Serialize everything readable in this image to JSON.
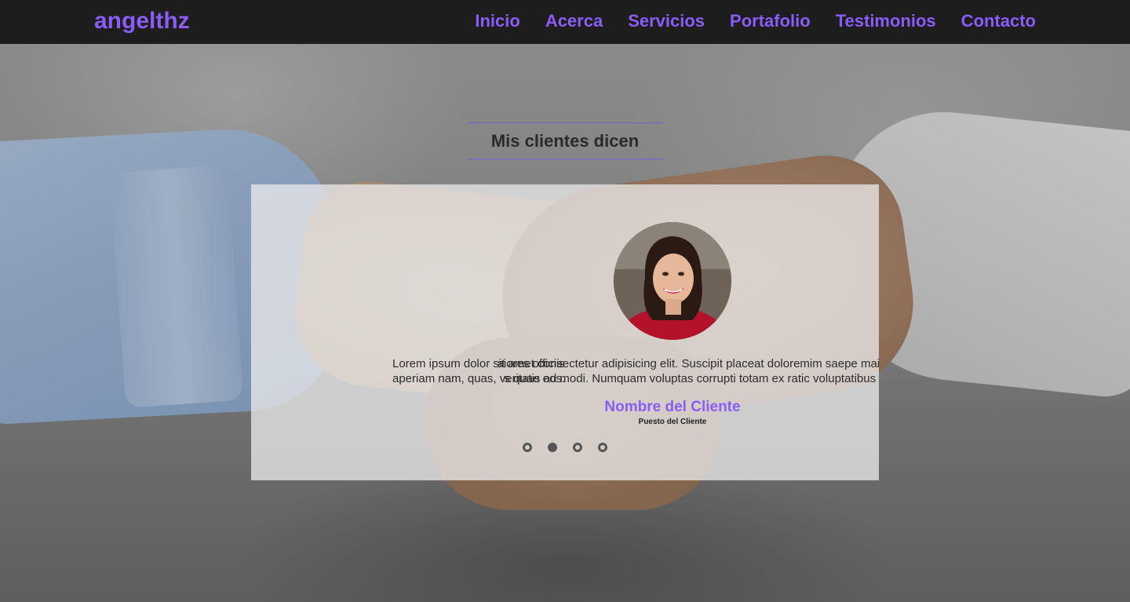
{
  "header": {
    "brand": "angelthz",
    "nav": [
      "Inicio",
      "Acerca",
      "Servicios",
      "Portafolio",
      "Testimonios",
      "Contacto"
    ]
  },
  "section": {
    "title": "Mis clientes dicen"
  },
  "testimonial": {
    "quote_line1": "Lorem ipsum dolor sit amet consectetur adipisicing elit. Suscipit placeat doloremim saepe maior",
    "quote_line2": "aperiam nam, quas, veritatis ad modi. Numquam voluptas corrupti totam ex ratic voluptatibus qu",
    "prev_line1": "aiores officiis",
    "prev_line2": "s quae eos.",
    "client_name": "Nombre del Cliente",
    "client_role": "Puesto del Cliente"
  },
  "carousel": {
    "total": 4,
    "active_index": 1
  },
  "colors": {
    "accent": "#8b5cf6",
    "header_bg": "#1d1d1d"
  }
}
